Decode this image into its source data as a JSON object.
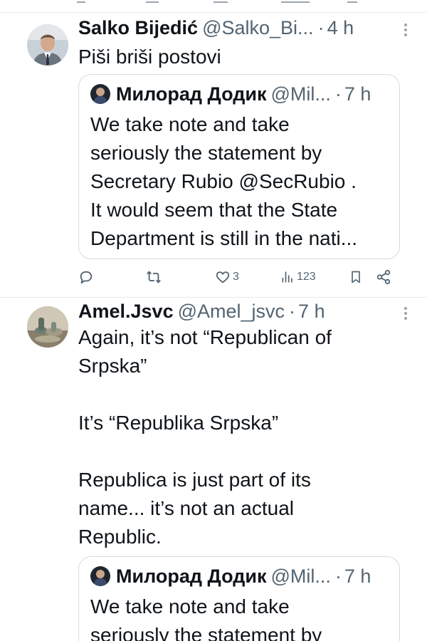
{
  "tweets": [
    {
      "author": {
        "name": "Salko Bijedić",
        "handle": "@Salko_Bi...",
        "time": "4 h",
        "avatar": "man-portrait"
      },
      "text": "Piši briši postovi",
      "quote": {
        "author": {
          "name": "Милорад Додик",
          "handle": "@Mil...",
          "time": "7 h"
        },
        "text": "We take note and take\nseriously the statement by\nSecretary Rubio @SecRubio .\nIt would seem that the State\nDepartment is still in the nati..."
      },
      "actions": {
        "reply": {
          "icon": "reply-icon",
          "count": ""
        },
        "repost": {
          "icon": "repost-icon",
          "count": ""
        },
        "like": {
          "icon": "heart-icon",
          "count": "3"
        },
        "views": {
          "icon": "views-icon",
          "count": "123"
        },
        "bookmark": {
          "icon": "bookmark-icon"
        },
        "share": {
          "icon": "share-icon"
        }
      }
    },
    {
      "author": {
        "name": "Amel.Jsvc",
        "handle": "@Amel_jsvc",
        "time": "7 h",
        "avatar": "still-life-photo"
      },
      "text": "Again, it’s not “Republican of\nSrpska”\n\nIt’s “Republika Srpska”\n\nRepublica is just part of its\nname... it’s not an actual\nRepublic.",
      "quote": {
        "author": {
          "name": "Милорад Додик",
          "handle": "@Mil...",
          "time": "7 h"
        },
        "text": "We take note and take\nseriously the statement by"
      }
    }
  ],
  "colors": {
    "text": "#0f1419",
    "secondary": "#536471",
    "divider": "#e6e9ec",
    "border": "#d6dbe0"
  }
}
